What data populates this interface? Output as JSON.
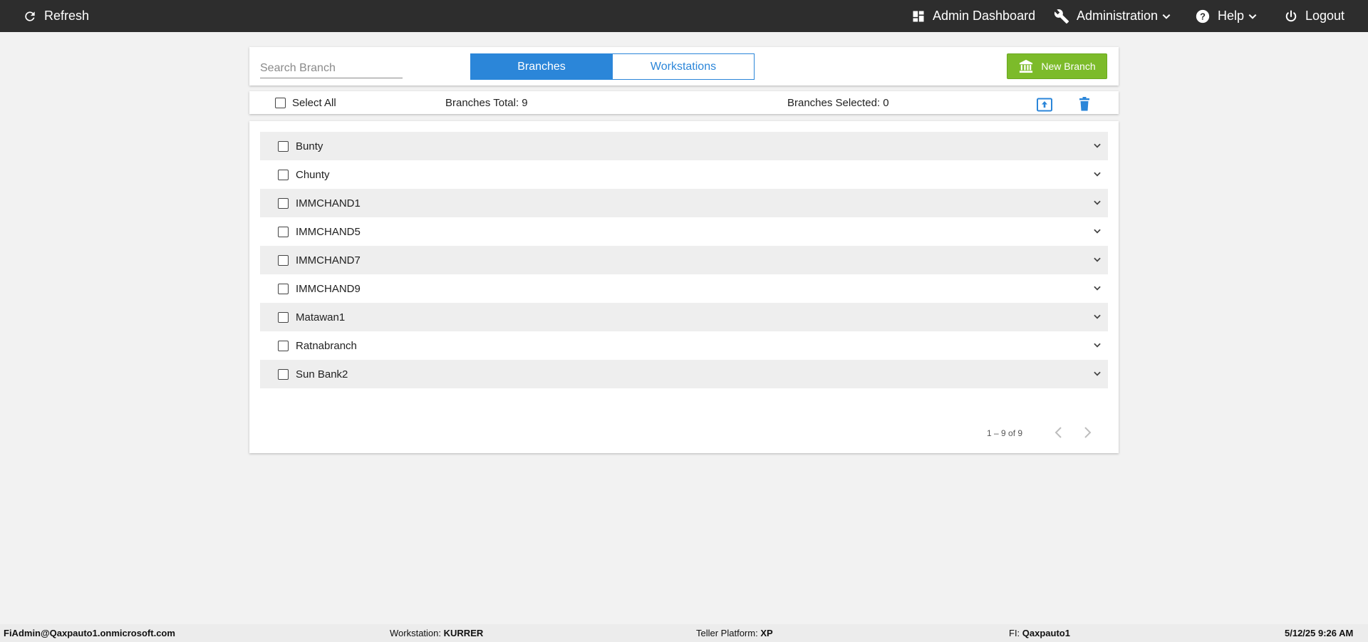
{
  "topbar": {
    "refresh_label": "Refresh",
    "dashboard_label": "Admin Dashboard",
    "administration_label": "Administration",
    "help_label": "Help",
    "logout_label": "Logout"
  },
  "header": {
    "search_placeholder": "Search Branch",
    "search_value": "",
    "tabs": [
      {
        "label": "Branches",
        "active": true
      },
      {
        "label": "Workstations",
        "active": false
      }
    ],
    "new_branch_label": "New Branch"
  },
  "toolbar": {
    "select_all_label": "Select All",
    "branches_total": "Branches Total: 9",
    "branches_selected": "Branches Selected: 0"
  },
  "branches": [
    {
      "name": "Bunty"
    },
    {
      "name": "Chunty"
    },
    {
      "name": "IMMCHAND1"
    },
    {
      "name": "IMMCHAND5"
    },
    {
      "name": "IMMCHAND7"
    },
    {
      "name": "IMMCHAND9"
    },
    {
      "name": "Matawan1"
    },
    {
      "name": "Ratnabranch"
    },
    {
      "name": "Sun Bank2"
    }
  ],
  "pagination": {
    "range_label": "1 – 9 of 9"
  },
  "footer": {
    "user": "FiAdmin@Qaxpauto1.onmicrosoft.com",
    "workstation_label": "Workstation:",
    "workstation_value": "KURRER",
    "teller_platform_label": "Teller Platform:",
    "teller_platform_value": "XP",
    "fi_label": "FI:",
    "fi_value": "Qaxpauto1",
    "datetime": "5/12/25 9:26 AM"
  },
  "colors": {
    "topbar_bg": "#2d2d2d",
    "accent_blue": "#2b86d9",
    "new_button_green": "#7cbb2a",
    "row_shade": "#eeeeee",
    "page_bg": "#f2f2f2"
  },
  "icons": {
    "refresh": "refresh-icon",
    "dashboard": "dashboard-icon",
    "administration": "wrench-icon",
    "help": "help-icon",
    "logout": "power-icon",
    "new_branch": "bank-icon",
    "export": "upload-icon",
    "delete": "trash-icon",
    "row_expand": "chevron-down-icon",
    "pager_prev": "chevron-left-icon",
    "pager_next": "chevron-right-icon"
  }
}
